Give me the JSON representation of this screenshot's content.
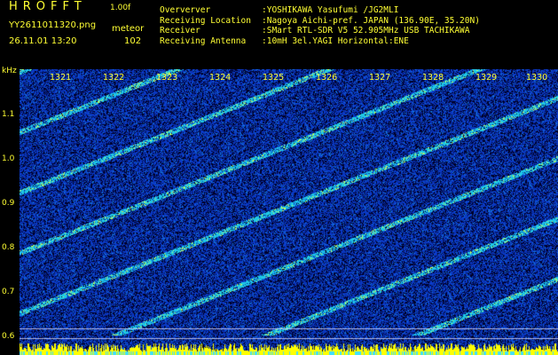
{
  "header": {
    "app_title": "HROFFT",
    "version": "1.00f",
    "filename": "YY2611011320.png",
    "mode": "meteor",
    "datetime": "26.11.01 13:20",
    "count": "102"
  },
  "info": [
    {
      "key": "Oververver",
      "value": ":YOSHIKAWA Yasufumi /JG2MLI"
    },
    {
      "key": "Receiving Location",
      "value": ":Nagoya Aichi-pref. JAPAN (136.90E, 35.20N)"
    },
    {
      "key": "Receiver",
      "value": ":SMart RTL-SDR V5 52.905MHz USB TACHIKAWA"
    },
    {
      "key": "Receiving Antenna",
      "value": ":10mH 3el.YAGI Horizontal:ENE"
    }
  ],
  "waterfall": {
    "unit": "kHz",
    "y_ticks": [
      "1.1",
      "1.0",
      "0.9",
      "0.8",
      "0.7",
      "0.6"
    ],
    "x_ticks": [
      "1321",
      "1322",
      "1323",
      "1324",
      "1325",
      "1326",
      "1327",
      "1328",
      "1329",
      "1330"
    ],
    "colors": {
      "background": "#000033",
      "noise": "#1030c8",
      "signal": "#20d0e0",
      "hot": "#d0ff60",
      "bottom_bar": "#ffff00"
    }
  }
}
